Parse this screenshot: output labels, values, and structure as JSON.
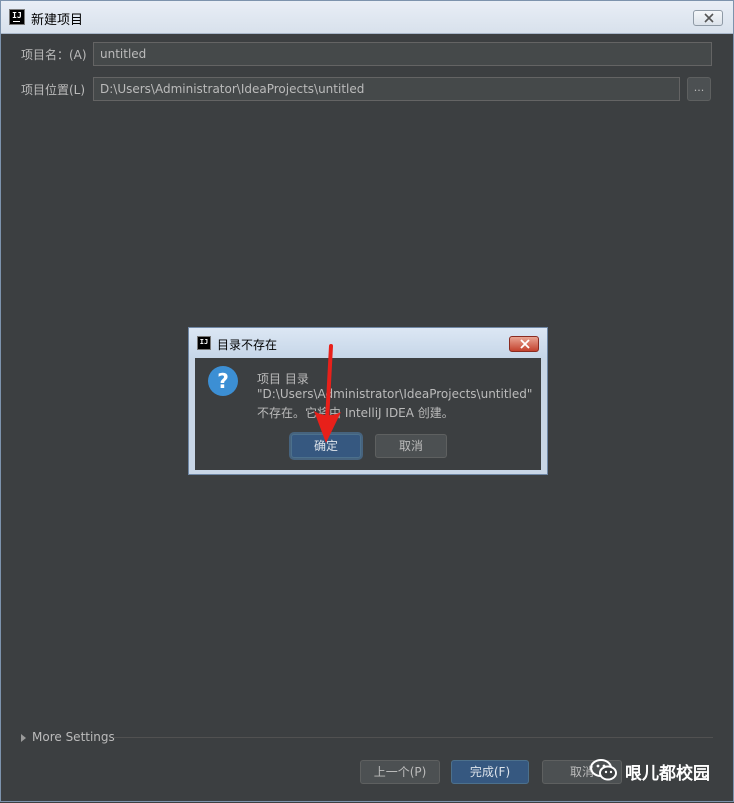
{
  "window": {
    "title": "新建项目"
  },
  "form": {
    "name_label": "项目名：(A)",
    "name_value": "untitled",
    "location_label": "项目位置(L)",
    "location_value": "D:\\Users\\Administrator\\IdeaProjects\\untitled",
    "browse_label": "..."
  },
  "dialog": {
    "title": "目录不存在",
    "message_line1": "项目 目录",
    "message_line2": "\"D:\\Users\\Administrator\\IdeaProjects\\untitled\"",
    "message_line3": "不存在。它将由 IntelliJ IDEA 创建。",
    "ok_label": "确定",
    "cancel_label": "取消"
  },
  "footer": {
    "more_settings": "More Settings",
    "prev_label": "上一个(P)",
    "finish_label": "完成(F)",
    "cancel_label": "取消"
  },
  "watermark": {
    "text": "哏儿都校园"
  },
  "colors": {
    "background": "#3c3f41",
    "primary_button": "#365880",
    "arrow": "#e8201a",
    "question_icon": "#3c8fd4"
  }
}
